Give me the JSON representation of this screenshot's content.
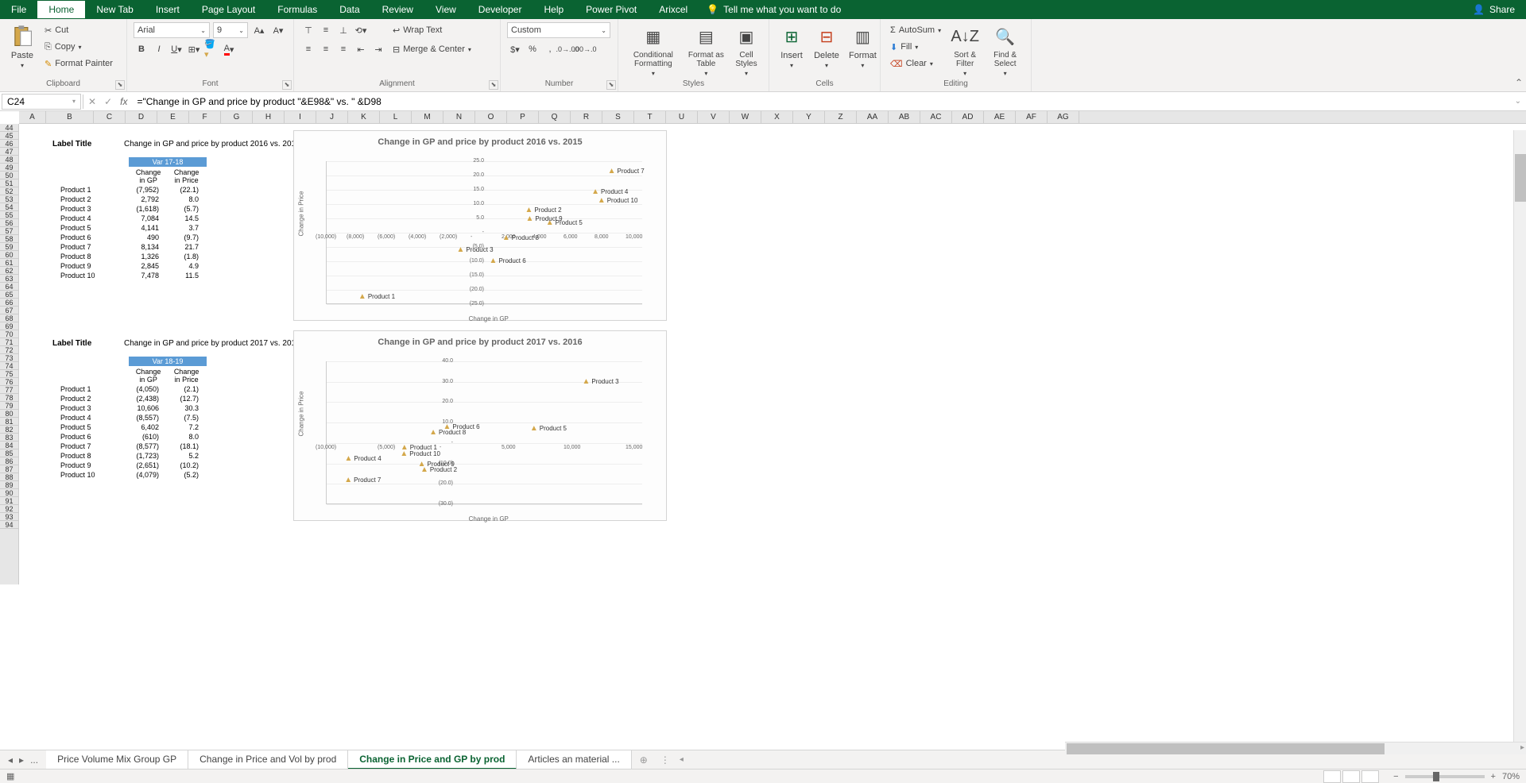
{
  "menu": {
    "items": [
      "File",
      "Home",
      "New Tab",
      "Insert",
      "Page Layout",
      "Formulas",
      "Data",
      "Review",
      "View",
      "Developer",
      "Help",
      "Power Pivot",
      "Arixcel"
    ],
    "tell_me": "Tell me what you want to do",
    "share": "Share"
  },
  "ribbon": {
    "clipboard": {
      "label": "Clipboard",
      "paste": "Paste",
      "cut": "Cut",
      "copy": "Copy",
      "format_painter": "Format Painter"
    },
    "font": {
      "label": "Font",
      "name": "Arial",
      "size": "9"
    },
    "alignment": {
      "label": "Alignment",
      "wrap": "Wrap Text",
      "merge": "Merge & Center"
    },
    "number": {
      "label": "Number",
      "format": "Custom"
    },
    "styles": {
      "label": "Styles",
      "conditional": "Conditional Formatting",
      "format_as": "Format as Table",
      "cell": "Cell Styles"
    },
    "cells": {
      "label": "Cells",
      "insert": "Insert",
      "delete": "Delete",
      "format": "Format"
    },
    "editing": {
      "label": "Editing",
      "autosum": "AutoSum",
      "fill": "Fill",
      "clear": "Clear",
      "sort": "Sort & Filter",
      "find": "Find & Select"
    }
  },
  "formula_bar": {
    "cell": "C24",
    "formula": "=\"Change in GP and price by product \"&E98&\" vs. \" &D98"
  },
  "columns": [
    "A",
    "B",
    "C",
    "D",
    "E",
    "F",
    "G",
    "H",
    "I",
    "J",
    "K",
    "L",
    "M",
    "N",
    "O",
    "P",
    "Q",
    "R",
    "S",
    "T",
    "U",
    "V",
    "W",
    "X",
    "Y",
    "Z",
    "AA",
    "AB",
    "AC",
    "AD",
    "AE",
    "AF",
    "AG"
  ],
  "rows_start": 44,
  "rows_end": 94,
  "block1": {
    "label_title": "Label Title",
    "title": "Change in GP and price by product 2016 vs. 2015",
    "var_header": "Var 17-18",
    "col_gp": "Change in GP",
    "col_price": "Change in Price",
    "rows": [
      {
        "p": "Product 1",
        "gp": "(7,952)",
        "pr": "(22.1)"
      },
      {
        "p": "Product 2",
        "gp": "2,792",
        "pr": "8.0"
      },
      {
        "p": "Product 3",
        "gp": "(1,618)",
        "pr": "(5.7)"
      },
      {
        "p": "Product 4",
        "gp": "7,084",
        "pr": "14.5"
      },
      {
        "p": "Product 5",
        "gp": "4,141",
        "pr": "3.7"
      },
      {
        "p": "Product 6",
        "gp": "490",
        "pr": "(9.7)"
      },
      {
        "p": "Product 7",
        "gp": "8,134",
        "pr": "21.7"
      },
      {
        "p": "Product 8",
        "gp": "1,326",
        "pr": "(1.8)"
      },
      {
        "p": "Product 9",
        "gp": "2,845",
        "pr": "4.9"
      },
      {
        "p": "Product 10",
        "gp": "7,478",
        "pr": "11.5"
      }
    ]
  },
  "block2": {
    "label_title": "Label Title",
    "title": "Change in GP and price by product 2017 vs. 2016",
    "var_header": "Var 18-19",
    "col_gp": "Change in GP",
    "col_price": "Change in Price",
    "rows": [
      {
        "p": "Product 1",
        "gp": "(4,050)",
        "pr": "(2.1)"
      },
      {
        "p": "Product 2",
        "gp": "(2,438)",
        "pr": "(12.7)"
      },
      {
        "p": "Product 3",
        "gp": "10,606",
        "pr": "30.3"
      },
      {
        "p": "Product 4",
        "gp": "(8,557)",
        "pr": "(7.5)"
      },
      {
        "p": "Product 5",
        "gp": "6,402",
        "pr": "7.2"
      },
      {
        "p": "Product 6",
        "gp": "(610)",
        "pr": "8.0"
      },
      {
        "p": "Product 7",
        "gp": "(8,577)",
        "pr": "(18.1)"
      },
      {
        "p": "Product 8",
        "gp": "(1,723)",
        "pr": "5.2"
      },
      {
        "p": "Product 9",
        "gp": "(2,651)",
        "pr": "(10.2)"
      },
      {
        "p": "Product 10",
        "gp": "(4,079)",
        "pr": "(5.2)"
      }
    ]
  },
  "chart1": {
    "title": "Change in GP and price by product 2016 vs. 2015",
    "xlabel": "Change in GP",
    "ylabel": "Change in Price",
    "y_ticks": [
      "25.0",
      "20.0",
      "15.0",
      "10.0",
      "5.0",
      "-",
      "(5.0)",
      "(10.0)",
      "(15.0)",
      "(20.0)",
      "(25.0)"
    ],
    "x_ticks": [
      "(10,000)",
      "(8,000)",
      "(6,000)",
      "(4,000)",
      "(2,000)",
      "-",
      "2,000",
      "4,000",
      "6,000",
      "8,000",
      "10,000"
    ]
  },
  "chart2": {
    "title": "Change in GP and price by product 2017 vs. 2016",
    "xlabel": "Change in GP",
    "ylabel": "Change in Price",
    "y_ticks": [
      "40.0",
      "30.0",
      "20.0",
      "10.0",
      "-",
      "(10.0)",
      "(20.0)",
      "(30.0)"
    ],
    "x_ticks": [
      "(10,000)",
      "(5,000)",
      "-",
      "5,000",
      "10,000",
      "15,000"
    ]
  },
  "chart_data": [
    {
      "type": "scatter",
      "title": "Change in GP and price by product 2016 vs. 2015",
      "xlabel": "Change in GP",
      "ylabel": "Change in Price",
      "xlim": [
        -10000,
        10000
      ],
      "ylim": [
        -25,
        25
      ],
      "series": [
        {
          "name": "Products",
          "points": [
            {
              "label": "Product 1",
              "x": -7952,
              "y": -22.1
            },
            {
              "label": "Product 2",
              "x": 2792,
              "y": 8.0
            },
            {
              "label": "Product 3",
              "x": -1618,
              "y": -5.7
            },
            {
              "label": "Product 4",
              "x": 7084,
              "y": 14.5
            },
            {
              "label": "Product 5",
              "x": 4141,
              "y": 3.7
            },
            {
              "label": "Product 6",
              "x": 490,
              "y": -9.7
            },
            {
              "label": "Product 7",
              "x": 8134,
              "y": 21.7
            },
            {
              "label": "Product 8",
              "x": 1326,
              "y": -1.8
            },
            {
              "label": "Product 9",
              "x": 2845,
              "y": 4.9
            },
            {
              "label": "Product 10",
              "x": 7478,
              "y": 11.5
            }
          ]
        }
      ]
    },
    {
      "type": "scatter",
      "title": "Change in GP and price by product 2017 vs. 2016",
      "xlabel": "Change in GP",
      "ylabel": "Change in Price",
      "xlim": [
        -10000,
        15000
      ],
      "ylim": [
        -30,
        40
      ],
      "series": [
        {
          "name": "Products",
          "points": [
            {
              "label": "Product 1",
              "x": -4050,
              "y": -2.1
            },
            {
              "label": "Product 2",
              "x": -2438,
              "y": -12.7
            },
            {
              "label": "Product 3",
              "x": 10606,
              "y": 30.3
            },
            {
              "label": "Product 4",
              "x": -8557,
              "y": -7.5
            },
            {
              "label": "Product 5",
              "x": 6402,
              "y": 7.2
            },
            {
              "label": "Product 6",
              "x": -610,
              "y": 8.0
            },
            {
              "label": "Product 7",
              "x": -8577,
              "y": -18.1
            },
            {
              "label": "Product 8",
              "x": -1723,
              "y": 5.2
            },
            {
              "label": "Product 9",
              "x": -2651,
              "y": -10.2
            },
            {
              "label": "Product 10",
              "x": -4079,
              "y": -5.2
            }
          ]
        }
      ]
    }
  ],
  "sheet_tabs": {
    "nav_prev": "◂",
    "nav_next": "▸",
    "more": "...",
    "tabs": [
      "Price Volume Mix Group GP",
      "Change in Price and Vol by prod",
      "Change in Price and GP by prod",
      "Articles an material  ..."
    ],
    "active": 2,
    "add": "⊕"
  },
  "status": {
    "zoom": "70%"
  }
}
